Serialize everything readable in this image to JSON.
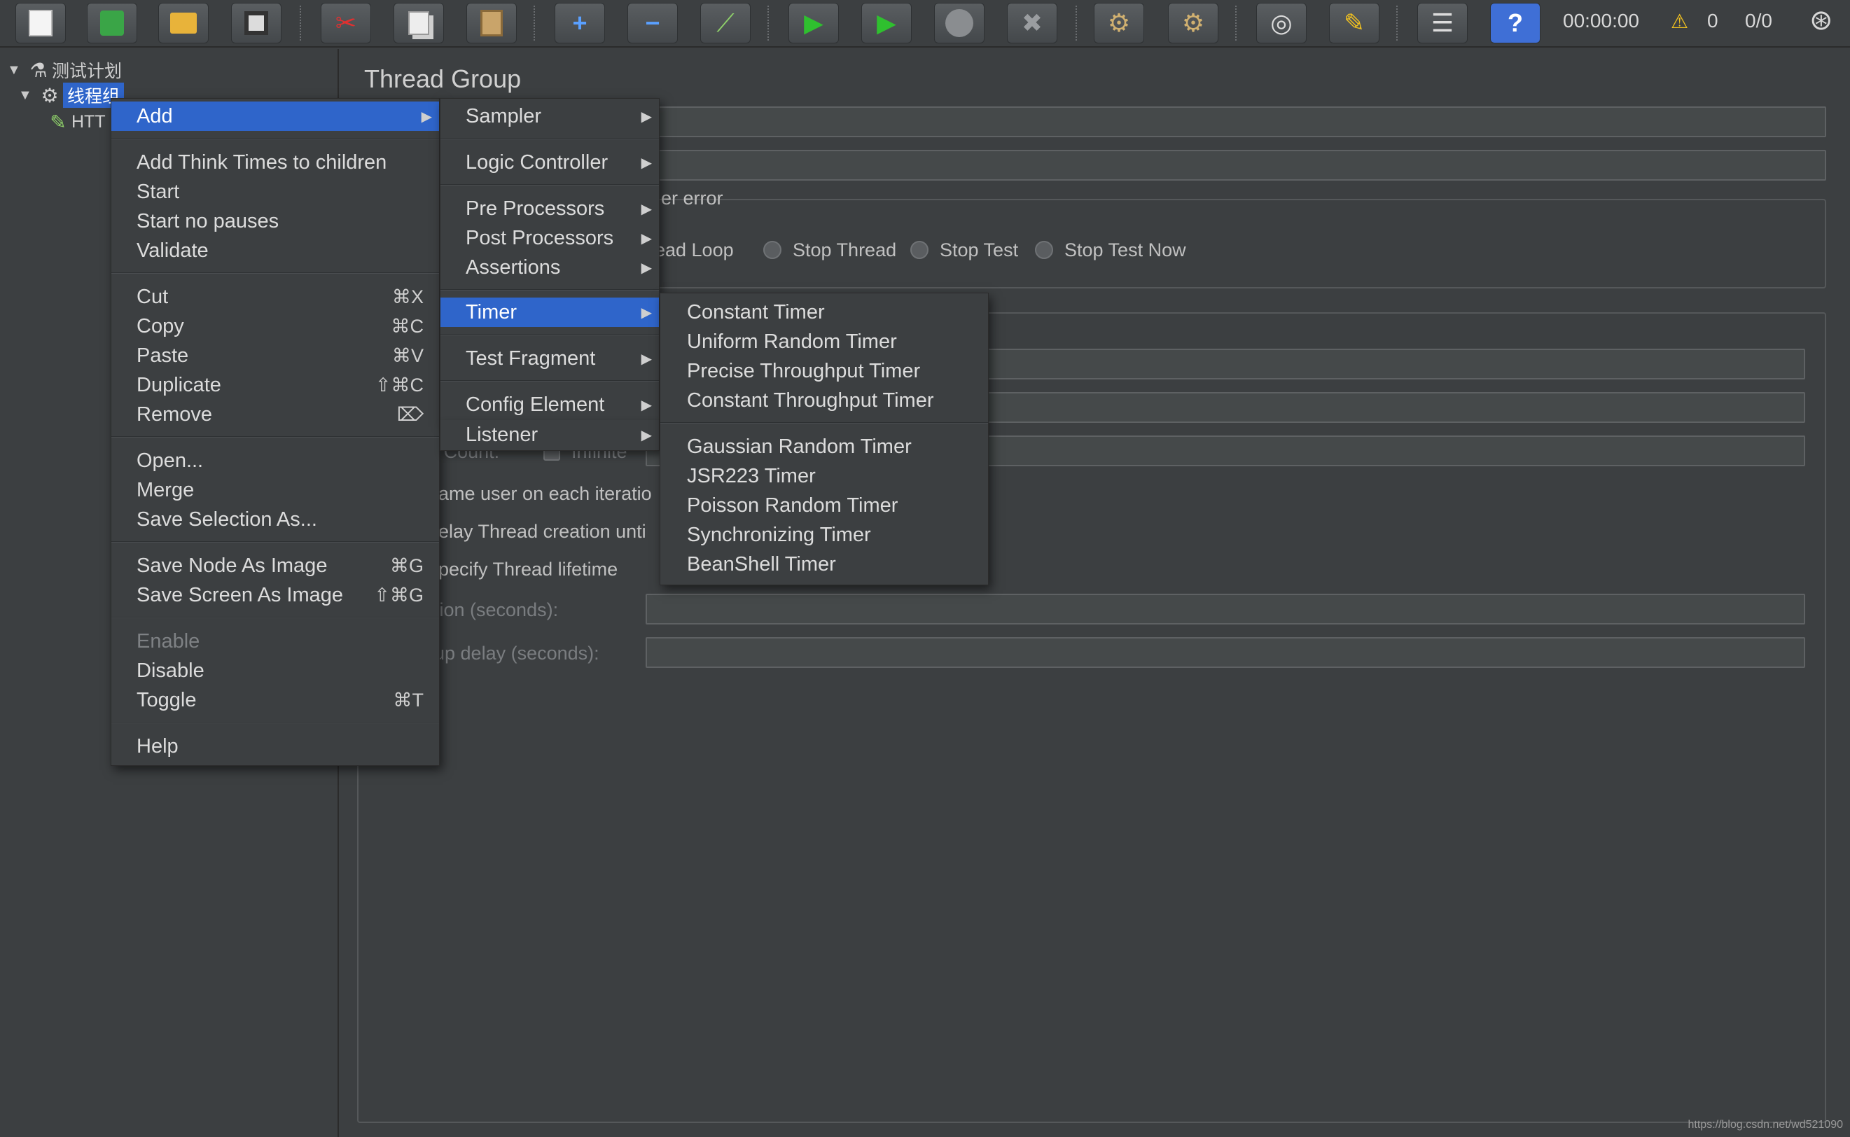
{
  "toolbar": {
    "icons": [
      "new-icon",
      "templates-icon",
      "open-icon",
      "save-icon",
      "cut-icon",
      "copy-icon",
      "paste-icon",
      "expand-icon",
      "collapse-icon",
      "toggle-icon",
      "start-icon",
      "start-no-pauses-icon",
      "stop-icon",
      "shutdown-icon",
      "clear-icon",
      "clear-all-icon",
      "search-icon",
      "reset-search-icon",
      "function-helper-icon",
      "help-icon"
    ],
    "elapsed_time": "00:00:00",
    "error_count": "0",
    "thread_ratio": "0/0"
  },
  "tree": {
    "test_plan": "测试计划",
    "thread_group": "线程组",
    "http_sampler": "HTT"
  },
  "detail": {
    "title": "Thread Group",
    "action_after_error": "er error",
    "radio_thread_loop": "read Loop",
    "radio_stop_thread": "Stop Thread",
    "radio_stop_test": "Stop Test",
    "radio_stop_test_now": "Stop Test Now",
    "loop_count": "Loop Count:",
    "infinite": "Infinite",
    "same_user": "ame user on each iteratio",
    "delay_creation": "elay Thread creation unti",
    "specify_lifetime": "pecify Thread lifetime",
    "duration": "tion (seconds):",
    "startup_delay": "up delay (seconds):",
    "watermark": "https://blog.csdn.net/wd521090"
  },
  "context_menu": {
    "add": "Add",
    "add_think_times": "Add Think Times to children",
    "start": "Start",
    "start_no_pauses": "Start no pauses",
    "validate": "Validate",
    "cut": "Cut",
    "cut_sc": "⌘X",
    "copy": "Copy",
    "copy_sc": "⌘C",
    "paste": "Paste",
    "paste_sc": "⌘V",
    "duplicate": "Duplicate",
    "duplicate_sc": "⇧⌘C",
    "remove": "Remove",
    "remove_sc": "⌦",
    "open": "Open...",
    "merge": "Merge",
    "save_selection": "Save Selection As...",
    "save_node_image": "Save Node As Image",
    "save_node_image_sc": "⌘G",
    "save_screen_image": "Save Screen As Image",
    "save_screen_image_sc": "⇧⌘G",
    "enable": "Enable",
    "disable": "Disable",
    "toggle": "Toggle",
    "toggle_sc": "⌘T",
    "help": "Help"
  },
  "add_menu": {
    "sampler": "Sampler",
    "logic_controller": "Logic Controller",
    "pre_processors": "Pre Processors",
    "post_processors": "Post Processors",
    "assertions": "Assertions",
    "timer": "Timer",
    "test_fragment": "Test Fragment",
    "config_element": "Config Element",
    "listener": "Listener"
  },
  "timer_menu": {
    "constant": "Constant Timer",
    "uniform_random": "Uniform Random Timer",
    "precise_throughput": "Precise Throughput Timer",
    "constant_throughput": "Constant Throughput Timer",
    "gaussian_random": "Gaussian Random Timer",
    "jsr223": "JSR223 Timer",
    "poisson_random": "Poisson Random Timer",
    "synchronizing": "Synchronizing Timer",
    "beanshell": "BeanShell Timer"
  },
  "colors": {
    "background": "#3c3f41",
    "selection": "#2f65ca",
    "text": "#dcdcdc"
  }
}
